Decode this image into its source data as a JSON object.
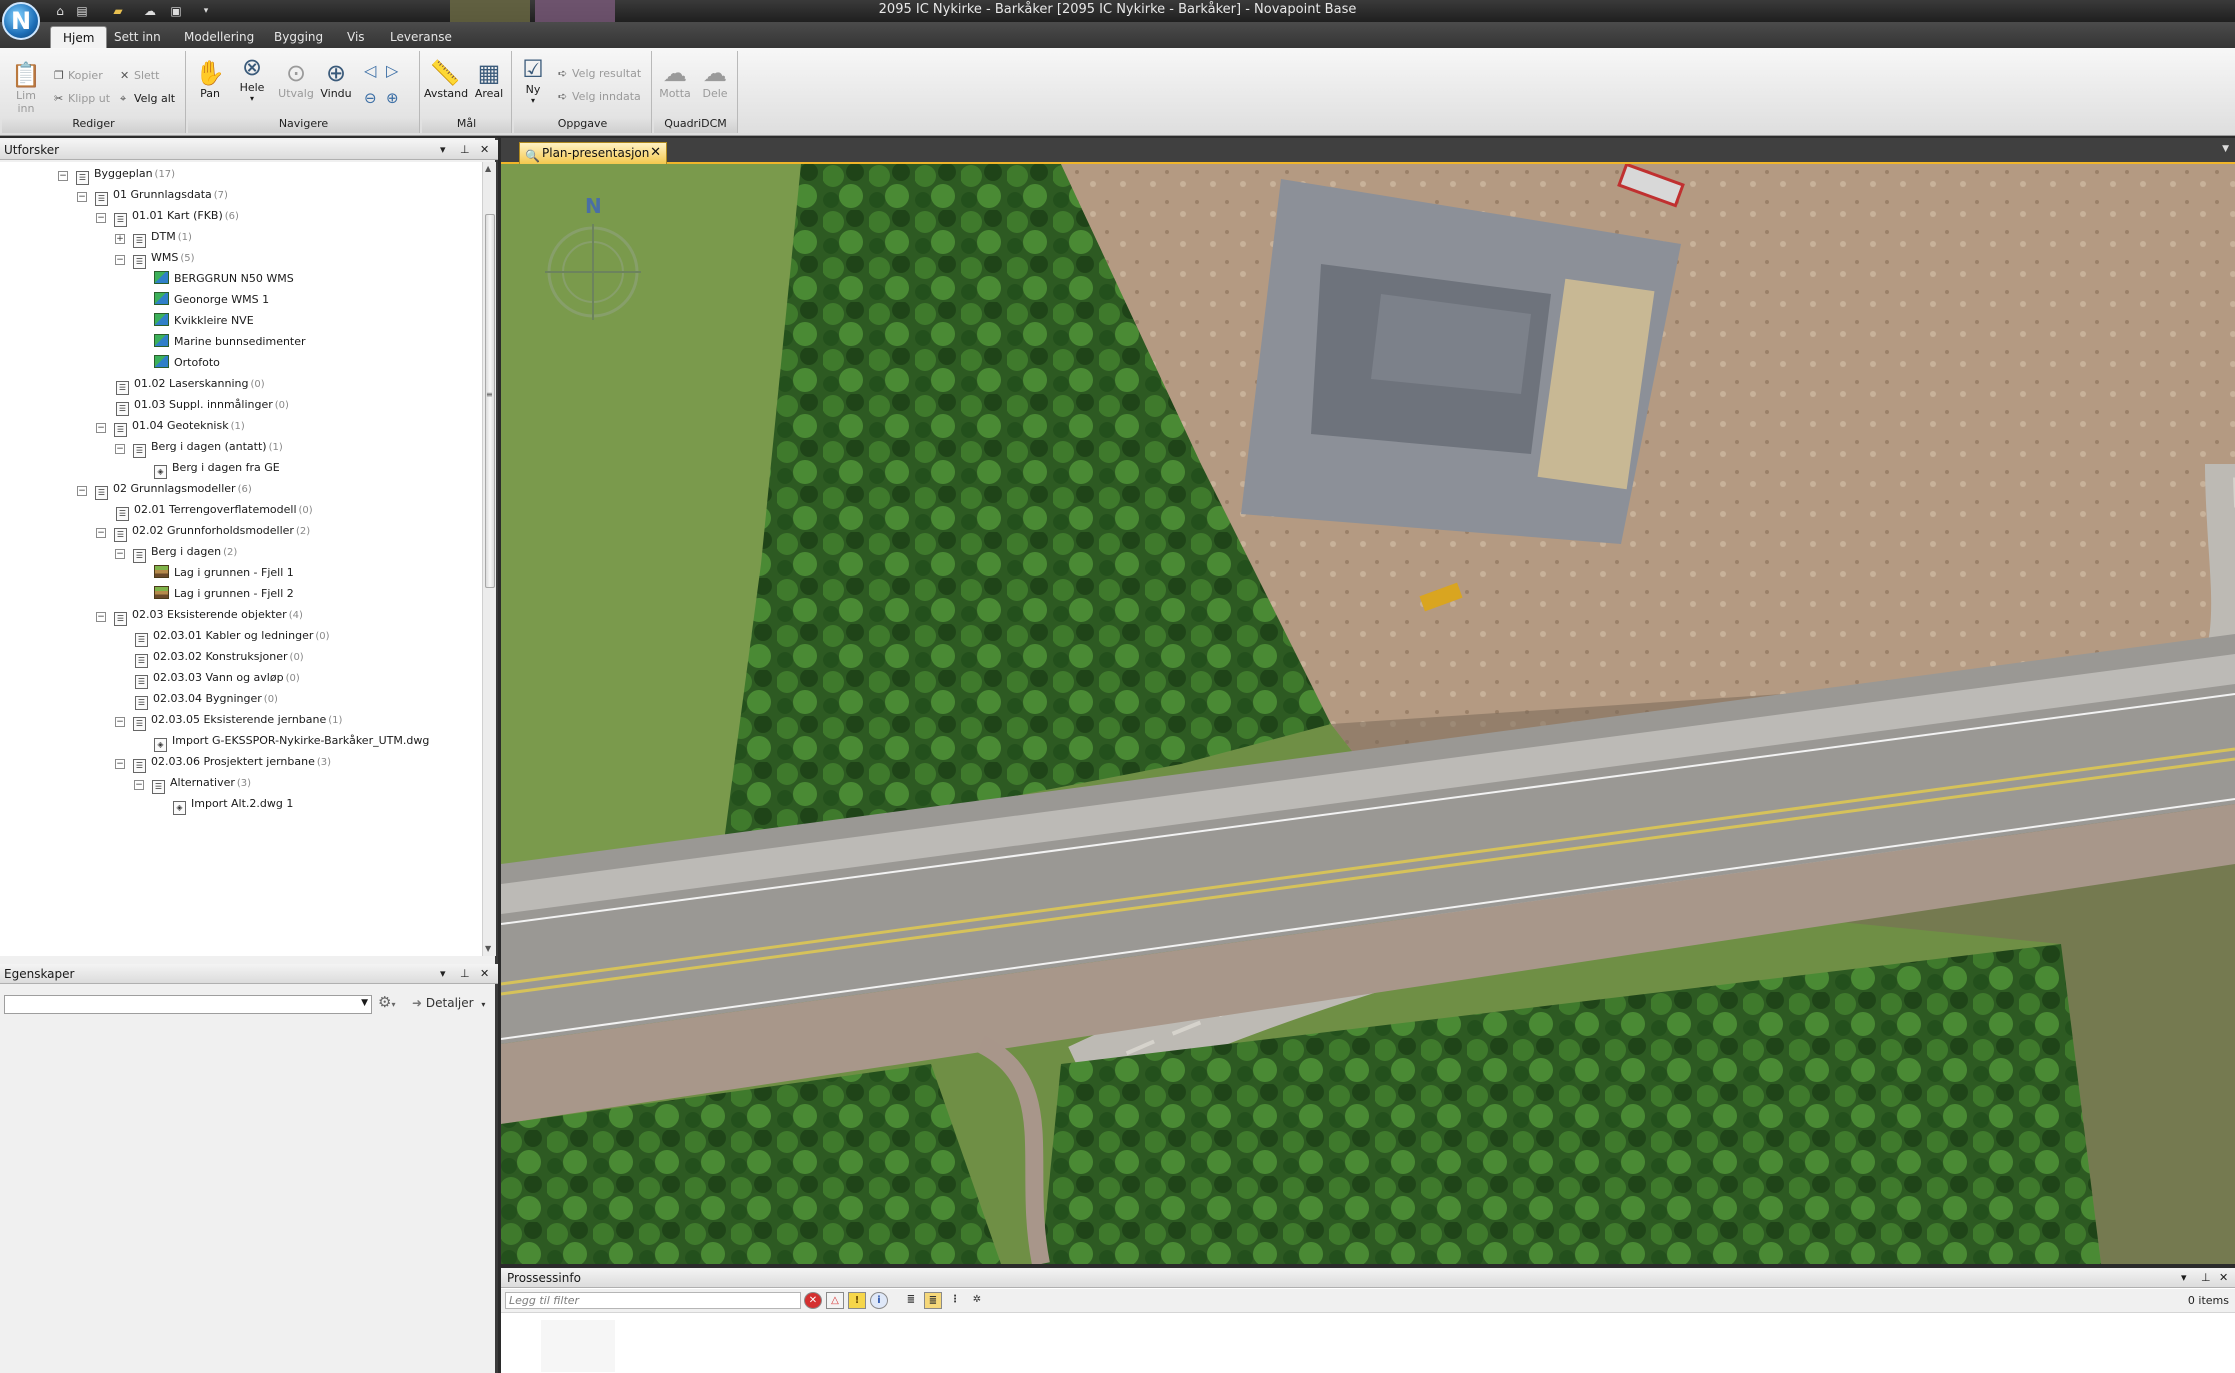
{
  "window": {
    "title": "2095 IC Nykirke - Barkåker [2095 IC Nykirke - Barkåker] - Novapoint Base",
    "app_logo": "N"
  },
  "ribbon_tabs": [
    "Hjem",
    "Sett inn",
    "Modellering",
    "Bygging",
    "Vis",
    "Leveranse"
  ],
  "ribbon": {
    "rediger": {
      "label": "Rediger",
      "lim_inn": "Lim inn",
      "kopier": "Kopier",
      "klipp_ut": "Klipp ut",
      "slett": "Slett",
      "velg_alt": "Velg alt"
    },
    "navigere": {
      "label": "Navigere",
      "pan": "Pan",
      "hele": "Hele",
      "utvalg": "Utvalg",
      "vindu": "Vindu"
    },
    "mal": {
      "label": "Mål",
      "avstand": "Avstand",
      "areal": "Areal"
    },
    "oppgave": {
      "label": "Oppgave",
      "ny": "Ny",
      "velg_resultat": "Velg resultat",
      "velg_inndata": "Velg inndata"
    },
    "quadridcm": {
      "label": "QuadriDCM",
      "motta": "Motta",
      "dele": "Dele"
    }
  },
  "explorer": {
    "title": "Utforsker",
    "tree": [
      {
        "label": "Byggeplan",
        "count": "(17)",
        "level": 0,
        "expander": "minus",
        "icon": "node"
      },
      {
        "label": "01 Grunnlagsdata",
        "count": "(7)",
        "level": 1,
        "expander": "minus",
        "icon": "node"
      },
      {
        "label": "01.01 Kart (FKB)",
        "count": "(6)",
        "level": 2,
        "expander": "minus",
        "icon": "node"
      },
      {
        "label": "DTM",
        "count": "(1)",
        "level": 3,
        "expander": "plus",
        "icon": "node"
      },
      {
        "label": "WMS",
        "count": "(5)",
        "level": 3,
        "expander": "minus",
        "icon": "node"
      },
      {
        "label": "BERGGRUN N50 WMS",
        "count": "",
        "level": 4,
        "expander": "none",
        "icon": "layer"
      },
      {
        "label": "Geonorge WMS 1",
        "count": "",
        "level": 4,
        "expander": "none",
        "icon": "layer"
      },
      {
        "label": "Kvikkleire NVE",
        "count": "",
        "level": 4,
        "expander": "none",
        "icon": "layer"
      },
      {
        "label": "Marine bunnsedimenter",
        "count": "",
        "level": 4,
        "expander": "none",
        "icon": "layer"
      },
      {
        "label": "Ortofoto",
        "count": "",
        "level": 4,
        "expander": "none",
        "icon": "layer"
      },
      {
        "label": "01.02 Laserskanning",
        "count": "(0)",
        "level": 2,
        "expander": "none",
        "icon": "node"
      },
      {
        "label": "01.03 Suppl. innmålinger",
        "count": "(0)",
        "level": 2,
        "expander": "none",
        "icon": "node"
      },
      {
        "label": "01.04 Geoteknisk",
        "count": "(1)",
        "level": 2,
        "expander": "minus",
        "icon": "node"
      },
      {
        "label": "Berg i dagen (antatt)",
        "count": "(1)",
        "level": 3,
        "expander": "minus",
        "icon": "node"
      },
      {
        "label": "Berg i dagen fra GE",
        "count": "",
        "level": 4,
        "expander": "none",
        "icon": "file"
      },
      {
        "label": "02 Grunnlagsmodeller",
        "count": "(6)",
        "level": 1,
        "expander": "minus",
        "icon": "node"
      },
      {
        "label": "02.01 Terrengoverflatemodell",
        "count": "(0)",
        "level": 2,
        "expander": "none",
        "icon": "node"
      },
      {
        "label": "02.02 Grunnforholdsmodeller",
        "count": "(2)",
        "level": 2,
        "expander": "minus",
        "icon": "node"
      },
      {
        "label": "Berg i dagen",
        "count": "(2)",
        "level": 3,
        "expander": "minus",
        "icon": "node"
      },
      {
        "label": "Lag i grunnen - Fjell 1",
        "count": "",
        "level": 4,
        "expander": "none",
        "icon": "ground"
      },
      {
        "label": "Lag i grunnen - Fjell 2",
        "count": "",
        "level": 4,
        "expander": "none",
        "icon": "ground"
      },
      {
        "label": "02.03 Eksisterende objekter",
        "count": "(4)",
        "level": 2,
        "expander": "minus",
        "icon": "node"
      },
      {
        "label": "02.03.01 Kabler og ledninger",
        "count": "(0)",
        "level": 3,
        "expander": "none",
        "icon": "node"
      },
      {
        "label": "02.03.02 Konstruksjoner",
        "count": "(0)",
        "level": 3,
        "expander": "none",
        "icon": "node"
      },
      {
        "label": "02.03.03 Vann og avløp",
        "count": "(0)",
        "level": 3,
        "expander": "none",
        "icon": "node"
      },
      {
        "label": "02.03.04 Bygninger",
        "count": "(0)",
        "level": 3,
        "expander": "none",
        "icon": "node"
      },
      {
        "label": "02.03.05 Eksisterende jernbane",
        "count": "(1)",
        "level": 3,
        "expander": "minus",
        "icon": "node"
      },
      {
        "label": "Import G-EKSSPOR-Nykirke-Barkåker_UTM.dwg",
        "count": "",
        "level": 4,
        "expander": "none",
        "icon": "file"
      },
      {
        "label": "02.03.06 Prosjektert jernbane",
        "count": "(3)",
        "level": 3,
        "expander": "minus",
        "icon": "node"
      },
      {
        "label": "Alternativer",
        "count": "(3)",
        "level": 4,
        "expander": "minus",
        "icon": "node"
      },
      {
        "label": "Import Alt.2.dwg 1",
        "count": "",
        "level": 5,
        "expander": "none",
        "icon": "file"
      }
    ]
  },
  "properties": {
    "title": "Egenskaper",
    "selector_value": "",
    "details_label": "Detaljer"
  },
  "document": {
    "tab_label": "Plan-presentasjon",
    "north_label": "N"
  },
  "process_info": {
    "title": "Prossessinfo",
    "filter_placeholder": "Legg til filter",
    "items_count": "0 items"
  },
  "colors": {
    "title_bar": "#2a2a2a",
    "doc_tab": "#f4c84e",
    "accent": "#f0b52a"
  }
}
